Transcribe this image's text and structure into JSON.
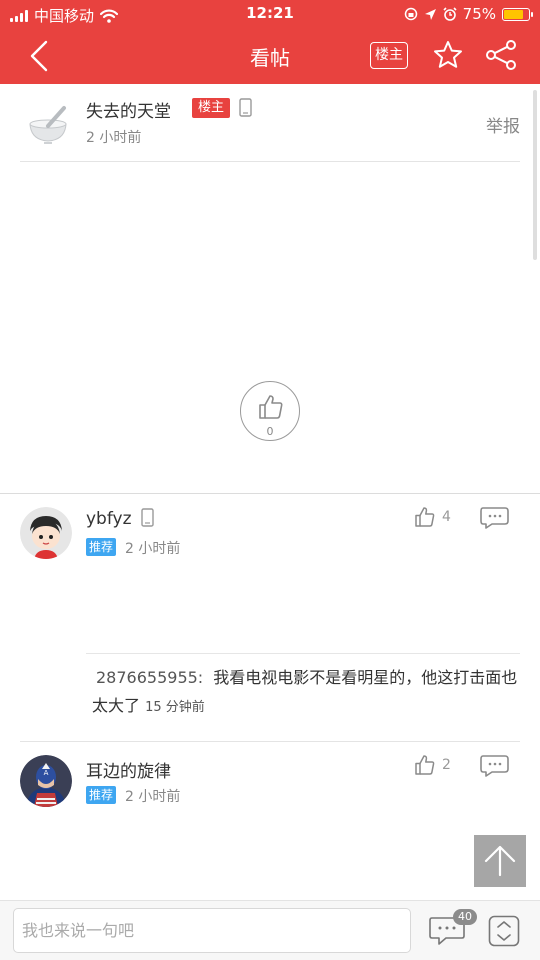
{
  "status_bar": {
    "carrier": "中国移动",
    "time": "12:21",
    "battery": "75%"
  },
  "nav": {
    "title": "看帖",
    "owner_only_label": "楼主"
  },
  "post": {
    "author": "失去的天堂",
    "owner_badge": "楼主",
    "time": "2 小时前",
    "report_label": "举报",
    "like_count": "0"
  },
  "comments": [
    {
      "name": "ybfyz",
      "badge": "推荐",
      "time": "2 小时前",
      "like_count": "4",
      "reply": {
        "user": "2876655955:",
        "text": "我看电视电影不是看明星的，他这打击面也太大了",
        "time": "15 分钟前"
      }
    },
    {
      "name": "耳边的旋律",
      "badge": "推荐",
      "time": "2 小时前",
      "like_count": "2"
    }
  ],
  "bottom_bar": {
    "input_placeholder": "我也来说一句吧",
    "comment_count": "40"
  },
  "colors": {
    "brand_red": "#e8423f",
    "recommend_blue": "#3ea6f1"
  }
}
